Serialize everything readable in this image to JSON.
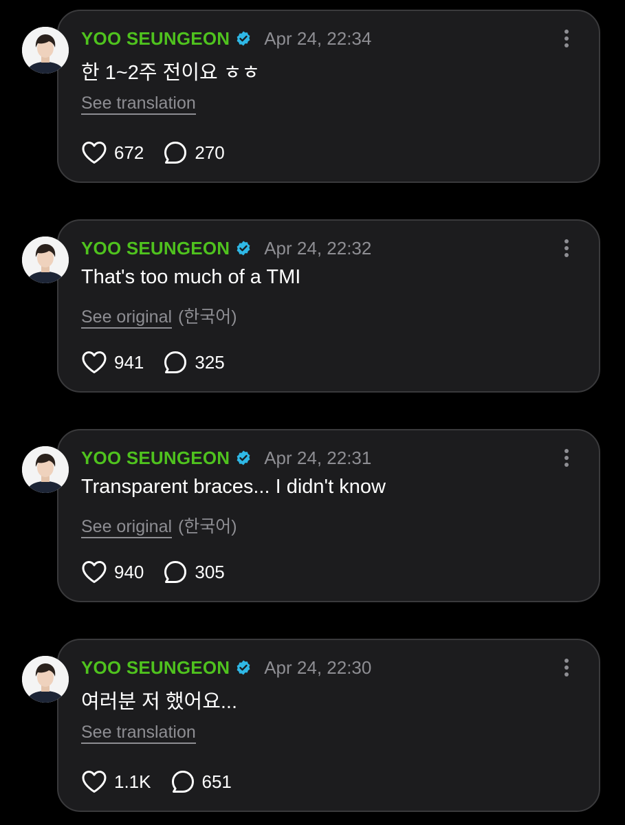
{
  "colors": {
    "background": "#000000",
    "card": "#1c1c1e",
    "card_border": "#3a3a3c",
    "author": "#4fc21e",
    "verified_badge": "#2fb8e6",
    "muted_text": "#8e8e93",
    "primary_text": "#ffffff"
  },
  "posts": [
    {
      "author": "YOO SEUNGEON",
      "verified_icon": "verified-badge-icon",
      "timestamp": "Apr 24, 22:34",
      "message": "한 1~2주 전이요 ㅎㅎ",
      "translate_link": "See translation",
      "translate_note": "",
      "likes": "672",
      "comments": "270"
    },
    {
      "author": "YOO SEUNGEON",
      "verified_icon": "verified-badge-icon",
      "timestamp": "Apr 24, 22:32",
      "message": "That's too much of a TMI",
      "translate_link": "See original",
      "translate_note": "(한국어)",
      "likes": "941",
      "comments": "325"
    },
    {
      "author": "YOO SEUNGEON",
      "verified_icon": "verified-badge-icon",
      "timestamp": "Apr 24, 22:31",
      "message": "Transparent braces... I didn't know",
      "translate_link": "See original",
      "translate_note": "(한국어)",
      "likes": "940",
      "comments": "305"
    },
    {
      "author": "YOO SEUNGEON",
      "verified_icon": "verified-badge-icon",
      "timestamp": "Apr 24, 22:30",
      "message": "여러분 저 했어요...",
      "translate_link": "See translation",
      "translate_note": "",
      "likes": "1.1K",
      "comments": "651"
    }
  ]
}
